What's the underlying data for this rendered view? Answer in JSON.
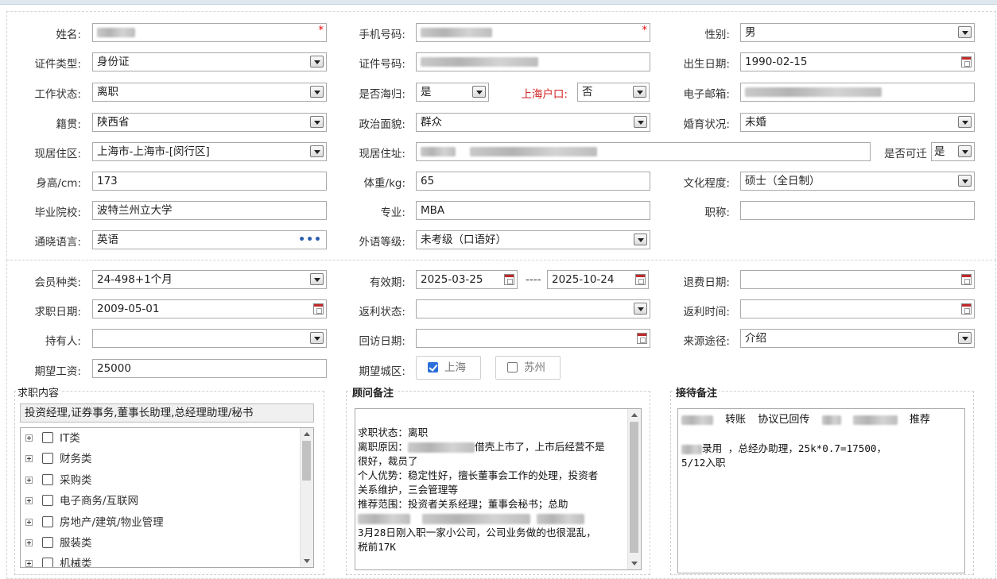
{
  "personal": {
    "name": {
      "label": "姓名:"
    },
    "phone": {
      "label": "手机号码:"
    },
    "gender": {
      "label": "性别:",
      "value": "男"
    },
    "id_type": {
      "label": "证件类型:",
      "value": "身份证"
    },
    "id_number": {
      "label": "证件号码:"
    },
    "birth_date": {
      "label": "出生日期:",
      "value": "1990-02-15"
    },
    "work_status": {
      "label": "工作状态:",
      "value": "离职"
    },
    "overseas": {
      "label": "是否海归:",
      "value": "是"
    },
    "shanghai_hukou": {
      "label": "上海户口:",
      "value": "否"
    },
    "email": {
      "label": "电子邮箱:"
    },
    "native_place": {
      "label": "籍贯:",
      "value": "陕西省"
    },
    "political_status": {
      "label": "政治面貌:",
      "value": "群众"
    },
    "marital_status": {
      "label": "婚育状况:",
      "value": "未婚"
    },
    "residence_area": {
      "label": "现居住区:",
      "value": "上海市-上海市-[闵行区]"
    },
    "residence_address": {
      "label": "现居住址:"
    },
    "relocatable": {
      "label": "是否可迁",
      "value": "是"
    },
    "height": {
      "label": "身高/cm:",
      "value": "173"
    },
    "weight": {
      "label": "体重/kg:",
      "value": "65"
    },
    "education": {
      "label": "文化程度:",
      "value": "硕士（全日制）"
    },
    "school": {
      "label": "毕业院校:",
      "value": "波特兰州立大学"
    },
    "major": {
      "label": "专业:",
      "value": "MBA"
    },
    "title": {
      "label": "职称:",
      "value": ""
    },
    "languages": {
      "label": "通晓语言:",
      "value": "英语",
      "more": "•••"
    },
    "language_level": {
      "label": "外语等级:",
      "value": "未考级（口语好）"
    }
  },
  "membership": {
    "type": {
      "label": "会员种类:",
      "value": "24-498+1个月"
    },
    "validity": {
      "label": "有效期:",
      "from": "2025-03-25",
      "sep": "----",
      "to": "2025-10-24"
    },
    "refund_date": {
      "label": "退费日期:",
      "value": ""
    },
    "job_search_date": {
      "label": "求职日期:",
      "value": "2009-05-01"
    },
    "rebate_status": {
      "label": "返利状态:",
      "value": ""
    },
    "rebate_time": {
      "label": "返利时间:",
      "value": ""
    },
    "holder": {
      "label": "持有人:",
      "value": ""
    },
    "revisit_date": {
      "label": "回访日期:",
      "value": ""
    },
    "source": {
      "label": "来源途径:",
      "value": "介绍"
    },
    "expected_salary": {
      "label": "期望工资:",
      "value": "25000"
    },
    "expected_city": {
      "label": "期望城区:",
      "options": [
        {
          "label": "上海",
          "checked": true
        },
        {
          "label": "苏州",
          "checked": false
        }
      ]
    }
  },
  "job_content": {
    "title": "求职内容",
    "summary": "投资经理,证券事务,董事长助理,总经理助理/秘书",
    "categories": [
      "IT类",
      "财务类",
      "采购类",
      "电子商务/互联网",
      "房地产/建筑/物业管理",
      "服装类",
      "机械类"
    ]
  },
  "consultant_notes": {
    "title": "顾问备注",
    "lines": [
      "求职状态：离职",
      "借壳上市了，上市后经营不是",
      "很好，裁员了",
      "个人优势：稳定性好，擅长董事会工作的处理，投资者",
      "关系维护，三会管理等",
      "推荐范围：投资者关系经理；董事会秘书；总助",
      "",
      "",
      "3月28日刚入职一家小公司，公司业务做的也很混乱，",
      "税前17K"
    ],
    "prefix_reason": "离职原因："
  },
  "reception_notes": {
    "title": "接待备注",
    "line1_a": "转账",
    "line1_b": "协议已回传",
    "line1_c": "推荐",
    "line2": "录用 ，总经办助理，25k*0.7=17500，",
    "line3": "5/12入职"
  }
}
